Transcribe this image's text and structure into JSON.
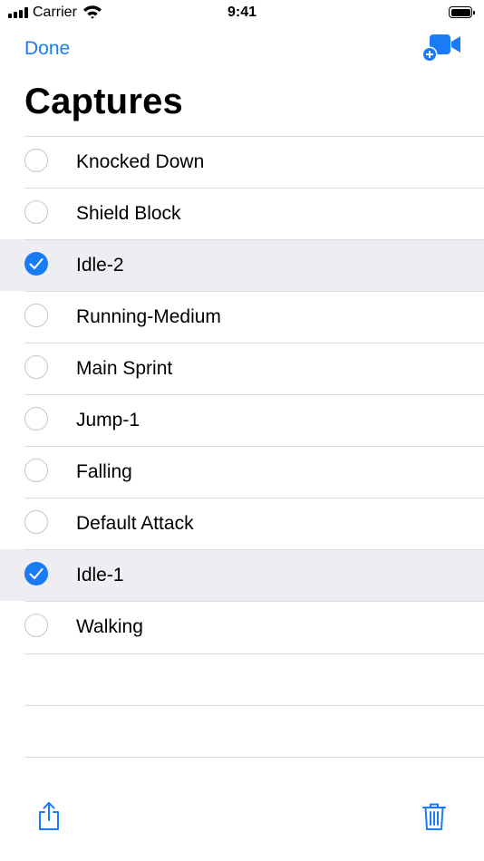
{
  "status_bar": {
    "carrier": "Carrier",
    "time": "9:41"
  },
  "nav": {
    "done_label": "Done"
  },
  "page": {
    "title": "Captures"
  },
  "captures": [
    {
      "label": "Knocked Down",
      "selected": false
    },
    {
      "label": "Shield Block",
      "selected": false
    },
    {
      "label": "Idle-2",
      "selected": true
    },
    {
      "label": "Running-Medium",
      "selected": false
    },
    {
      "label": "Main Sprint",
      "selected": false
    },
    {
      "label": "Jump-1",
      "selected": false
    },
    {
      "label": "Falling",
      "selected": false
    },
    {
      "label": "Default Attack",
      "selected": false
    },
    {
      "label": "Idle-1",
      "selected": true
    },
    {
      "label": "Walking",
      "selected": false
    }
  ],
  "icons": {
    "add_video": "video-plus-icon",
    "share": "share-icon",
    "trash": "trash-icon"
  },
  "colors": {
    "accent": "#1a7cf5",
    "selected_row": "#eeeef2",
    "separator": "#dcdcdf"
  }
}
